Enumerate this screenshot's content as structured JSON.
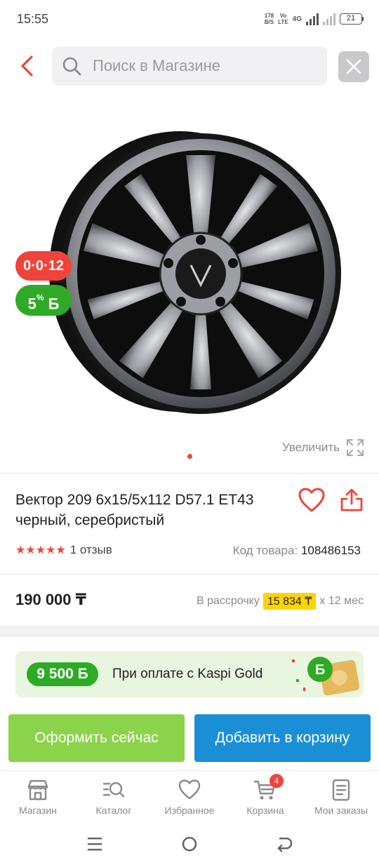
{
  "status_bar": {
    "time": "15:55",
    "net_speed_value": "178",
    "net_speed_unit": "B/S",
    "volte_top": "Vo",
    "volte_bottom": "LTE",
    "network": "4G",
    "battery": "21"
  },
  "search": {
    "placeholder": "Поиск в Магазине"
  },
  "gallery": {
    "timer_badge": "0·0·12",
    "bonus_badge_value": "5",
    "bonus_badge_suffix": "%",
    "bonus_badge_currency": "Б",
    "zoom_label": "Увеличить",
    "slide_count": 1
  },
  "product": {
    "title": "Вектор 209 6x15/5x112 D57.1 ET43 черный, серебристый",
    "rating_stars": "★★★★★",
    "rating_value": 5,
    "reviews": "1 отзыв",
    "code_label": "Код товара:",
    "code_value": "108486153",
    "price": "190 000 ₸",
    "installment_prefix": "В рассрочку",
    "installment_amount": "15 834 ₸",
    "installment_suffix": "x 12 мес"
  },
  "promo": {
    "bonus": "9 500 Б",
    "text": "При оплате с Kaspi Gold"
  },
  "actions": {
    "buy_now": "Оформить сейчас",
    "add_to_cart": "Добавить в корзину"
  },
  "bottom_nav": {
    "items": [
      {
        "label": "Магазин",
        "icon": "shop-icon"
      },
      {
        "label": "Каталог",
        "icon": "catalog-search-icon"
      },
      {
        "label": "Избранное",
        "icon": "heart-icon"
      },
      {
        "label": "Корзина",
        "icon": "cart-icon",
        "badge": "4"
      },
      {
        "label": "Мои заказы",
        "icon": "orders-icon"
      }
    ]
  },
  "colors": {
    "accent_red": "#f0433a",
    "bonus_green": "#2eaa26",
    "buy_green": "#8cd34c",
    "cart_blue": "#1b8fd6",
    "installment_yellow": "#ffd400"
  }
}
